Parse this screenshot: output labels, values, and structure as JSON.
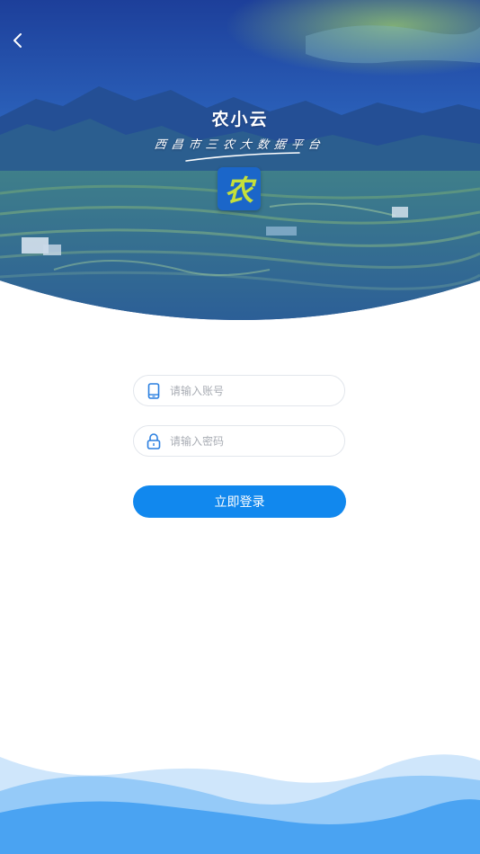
{
  "header": {
    "back_icon": "chevron-left-icon"
  },
  "brand": {
    "title": "农小云",
    "subtitle": "西昌市三农大数据平台",
    "logo_char": "农",
    "logo_bg": "#1b66c9",
    "logo_fg": "#c6e03a"
  },
  "form": {
    "account_placeholder": "请输入账号",
    "account_value": "",
    "account_icon": "phone-icon",
    "password_placeholder": "请输入密码",
    "password_value": "",
    "password_icon": "lock-icon",
    "login_label": "立即登录"
  },
  "colors": {
    "accent": "#1188ee",
    "hero_tint": "#1f4fa8",
    "icon": "#2a7fe0",
    "wave_light": "#cfe6fb",
    "wave_mid": "#8ec6f7",
    "wave_dark": "#4aa3f2"
  }
}
